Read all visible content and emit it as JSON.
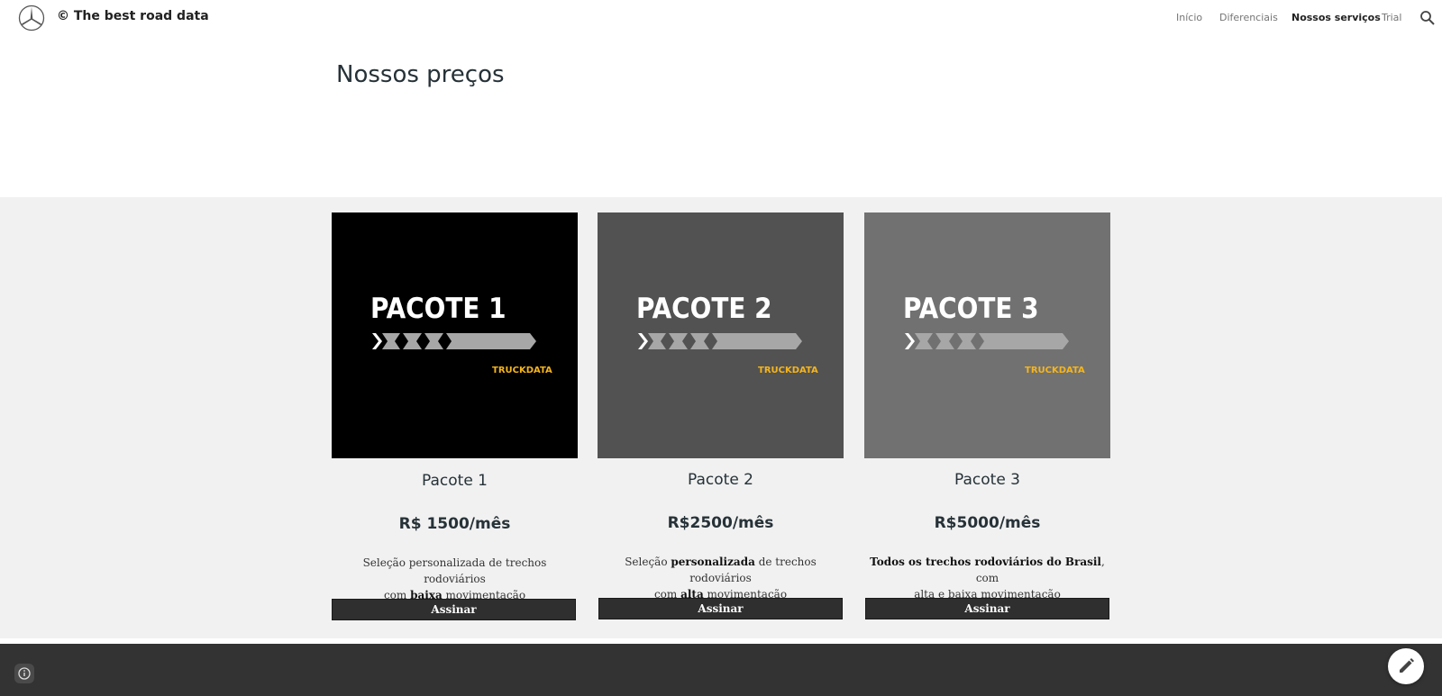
{
  "header": {
    "site_title": "The best road data",
    "copyright_symbol": "©",
    "nav": [
      "Início",
      "Diferenciais",
      "Nossos serviços",
      "Trial"
    ]
  },
  "page_title": "Nossos preços",
  "cards": [
    {
      "image_title": "PACOTE 1",
      "brand": "TRUCKDATA",
      "bg": "#000000",
      "name": "Pacote 1",
      "price": "R$ 1500/mês",
      "desc_parts": [
        "Seleção personalizada de trechos rodoviários",
        "com ",
        "baixa",
        " movimentação"
      ],
      "button": "Assinar"
    },
    {
      "image_title": "PACOTE 2",
      "brand": "TRUCKDATA",
      "bg": "#525252",
      "name": "Pacote 2",
      "price": "R$2500/mês",
      "desc_parts": [
        "Seleção ",
        "personalizada",
        " de trechos rodoviários",
        "com ",
        "alta",
        " movimentação"
      ],
      "button": "Assinar"
    },
    {
      "image_title": "PACOTE 3",
      "brand": "TRUCKDATA",
      "bg": "#717171",
      "name": "Pacote 3",
      "price": "R$5000/mês",
      "desc_parts": [
        "Todos os trechos rodoviários do Brasil",
        ", com",
        "alta e baixa movimentação"
      ],
      "button": "Assinar"
    }
  ],
  "colors": {
    "brand_yellow": "#f5b51c",
    "section_bg": "#f1f1f1",
    "footer_bg": "#333333",
    "button_bg": "#2f2f2f"
  },
  "icons": [
    "mercedes-star-logo",
    "search-icon",
    "info-icon",
    "pencil-icon"
  ]
}
